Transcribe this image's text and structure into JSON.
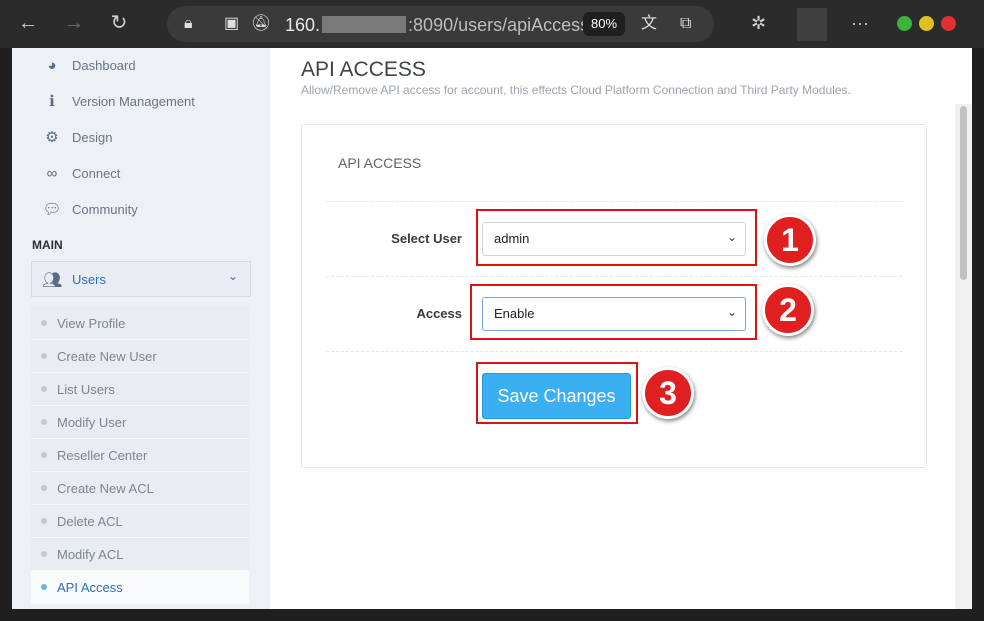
{
  "browser": {
    "url_prefix": "160.",
    "url_suffix": ":8090/users/apiAccess",
    "zoom": "80%",
    "icons": [
      "back-icon",
      "forward-icon",
      "refresh-icon",
      "lock-icon",
      "reader-icon",
      "notification-blocked-icon",
      "translate-icon",
      "collections-icon",
      "extensions-icon",
      "more-icon"
    ]
  },
  "sidebar": {
    "items": [
      {
        "label": "Dashboard",
        "icon": "dashboard-icon"
      },
      {
        "label": "Version Management",
        "icon": "info-icon"
      },
      {
        "label": "Design",
        "icon": "gear-icon"
      },
      {
        "label": "Connect",
        "icon": "link-icon"
      },
      {
        "label": "Community",
        "icon": "chat-icon"
      }
    ],
    "section": "MAIN",
    "users_label": "Users",
    "sub_items": [
      "View Profile",
      "Create New User",
      "List Users",
      "Modify User",
      "Reseller Center",
      "Create New ACL",
      "Delete ACL",
      "Modify ACL",
      "API Access"
    ],
    "active_sub": "API Access"
  },
  "main": {
    "title": "API ACCESS",
    "description": "Allow/Remove API access for account, this effects Cloud Platform Connection and Third Party Modules.",
    "card_title": "API ACCESS",
    "select_user_label": "Select User",
    "select_user_value": "admin",
    "access_label": "Access",
    "access_value": "Enable",
    "save_label": "Save Changes"
  },
  "annotations": {
    "step1": "1",
    "step2": "2",
    "step3": "3",
    "color": "#e01010"
  }
}
